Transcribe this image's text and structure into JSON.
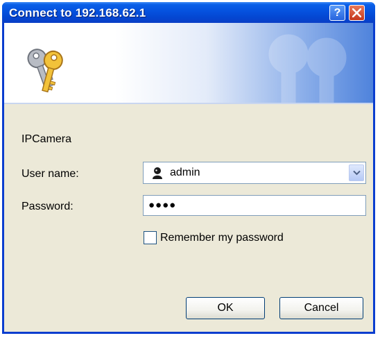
{
  "dialog": {
    "title": "Connect to 192.168.62.1",
    "help_icon": "help-icon",
    "close_icon": "close-icon",
    "banner_icon": "keys-icon"
  },
  "form": {
    "realm": "IPCamera",
    "username_label": "User name:",
    "username_value": "admin",
    "username_icon": "user-icon",
    "password_label": "Password:",
    "password_mask": "●●●●",
    "remember_label": "Remember my password",
    "remember_checked": false
  },
  "buttons": {
    "ok": "OK",
    "cancel": "Cancel"
  },
  "colors": {
    "titlebar": "#0551de",
    "dialog_bg": "#ece9d8",
    "close_button": "#c4371c"
  }
}
